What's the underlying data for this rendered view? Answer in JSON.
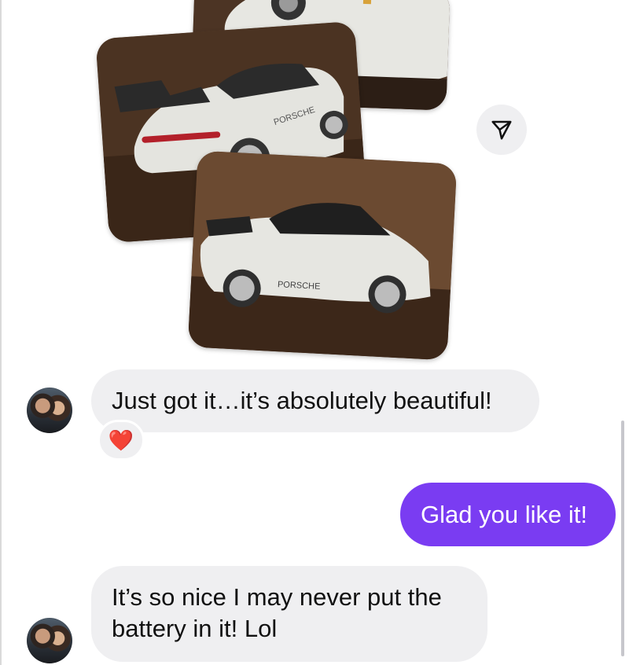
{
  "messages": [
    {
      "sender": "them",
      "text": "Just got it…it’s absolutely beautiful!",
      "reaction": "❤️"
    },
    {
      "sender": "me",
      "text": "Glad you like it!"
    },
    {
      "sender": "them",
      "lines": [
        "It’s so nice I may never put the",
        "battery in it! Lol"
      ]
    }
  ],
  "photo_stack": {
    "brand_text": "PORSCHE",
    "icon": "car-photo"
  },
  "icons": {
    "share": "paper-plane-icon",
    "reaction": "heart-icon"
  },
  "colors": {
    "outgoing_bubble": "#7a3cf2",
    "incoming_bubble": "#efeff1",
    "heart": "#e0245e"
  }
}
